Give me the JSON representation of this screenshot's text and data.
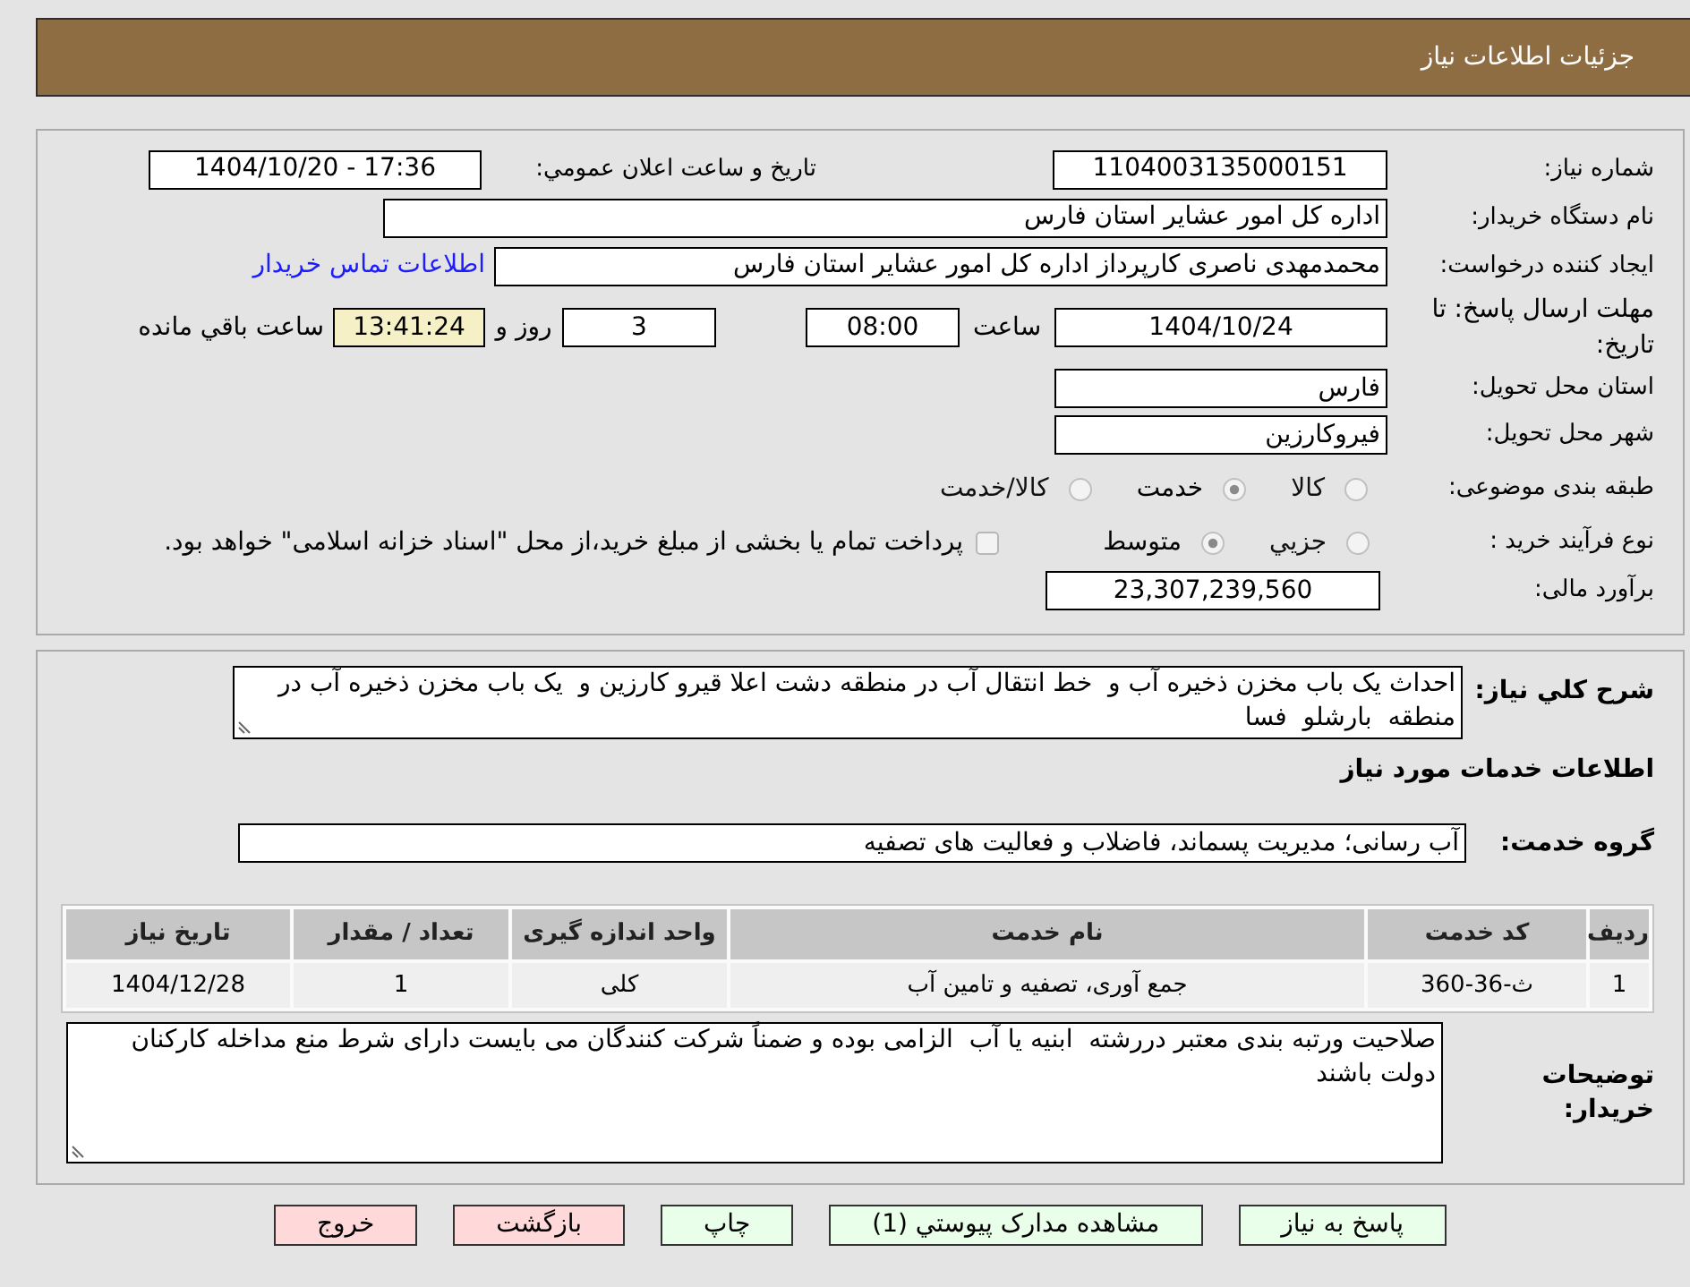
{
  "header": {
    "title": "جزئيات اطلاعات نياز"
  },
  "need_info": {
    "need_number": {
      "label": "شماره نياز:",
      "value": "1104003135000151"
    },
    "announce_datetime": {
      "label": "تاريخ و ساعت اعلان عمومي:",
      "value": "1404/10/20 - 17:36"
    },
    "buyer_org": {
      "label": "نام دستگاه خريدار:",
      "value": "اداره کل امور عشاير استان فارس"
    },
    "requester": {
      "label": "ايجاد کننده درخواست:",
      "value": "محمدمهدی ناصری کارپرداز اداره کل امور عشاير استان فارس",
      "contact_link": "اطلاعات تماس خريدار"
    },
    "deadline": {
      "label": "مهلت ارسال پاسخ: تا تاريخ:",
      "date": "1404/10/24",
      "time_label": "ساعت",
      "time": "08:00",
      "days": "3",
      "days_label": "روز و",
      "remaining": "13:41:24",
      "remaining_label": "ساعت باقي مانده"
    },
    "province": {
      "label": "استان محل تحويل:",
      "value": "فارس"
    },
    "city": {
      "label": "شهر محل تحويل:",
      "value": "فيروکارزين"
    },
    "category": {
      "label": "طبقه بندی موضوعی:",
      "options": [
        {
          "label": "کالا",
          "selected": false
        },
        {
          "label": "خدمت",
          "selected": true
        },
        {
          "label": "کالا/خدمت",
          "selected": false
        }
      ]
    },
    "process": {
      "label": "نوع فرآيند خريد :",
      "options": [
        {
          "label": "جزيي",
          "selected": false
        },
        {
          "label": "متوسط",
          "selected": true
        }
      ],
      "treasury_payment": {
        "checked": false,
        "text": "پرداخت تمام يا بخشی از مبلغ خريد،از محل \"اسناد خزانه اسلامی\" خواهد بود."
      }
    },
    "budget": {
      "label": "برآورد مالی:",
      "value": "23,307,239,560"
    }
  },
  "description": {
    "label": "شرح کلي نياز:",
    "text": "احداث يک باب مخزن ذخيره آب و  خط انتقال آب در منطقه دشت اعلا قيرو کارزين و  يک باب مخزن ذخيره آب در منطقه  بارشلو  فسا"
  },
  "services": {
    "title": "اطلاعات خدمات مورد نياز",
    "group": {
      "label": "گروه خدمت:",
      "value": "آب رسانی؛ مديريت پسماند، فاضلاب و فعاليت های تصفيه"
    },
    "table": {
      "columns": [
        "رديف",
        "کد خدمت",
        "نام خدمت",
        "واحد اندازه گيری",
        "تعداد / مقدار",
        "تاريخ نياز"
      ],
      "rows": [
        [
          "1",
          "ث-36-360",
          "جمع آوری، تصفيه و تامين آب",
          "کلی",
          "1",
          "1404/12/28"
        ]
      ]
    }
  },
  "buyer_notes": {
    "label": "توضيحات خريدار:",
    "text": "صلاحيت ورتبه بندی معتبر دررشته  ابنيه يا آب  الزامی بوده و ضمناً شرکت کنندگان می بايست دارای شرط منع مداخله کارکنان دولت باشند"
  },
  "buttons": [
    {
      "label": "پاسخ به نياز",
      "kind": "action"
    },
    {
      "label": "مشاهده مدارک پيوستي (1)",
      "kind": "action"
    },
    {
      "label": "چاپ",
      "kind": "action"
    },
    {
      "label": "بازگشت",
      "kind": "exit"
    },
    {
      "label": "خروج",
      "kind": "exit"
    }
  ]
}
